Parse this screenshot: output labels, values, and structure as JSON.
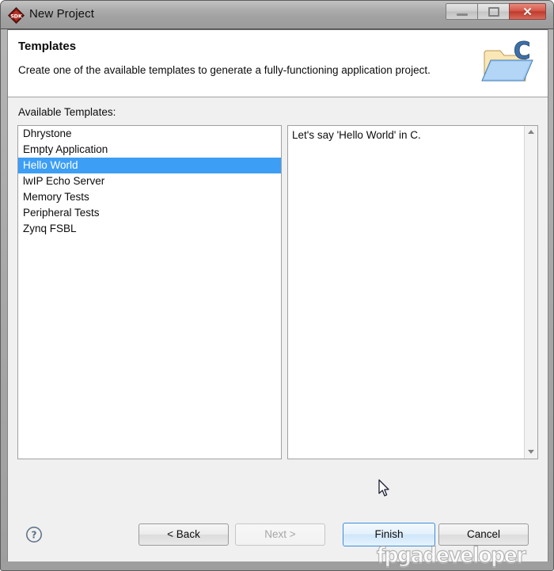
{
  "window": {
    "title": "New Project",
    "app_icon": "sdk-diamond-icon",
    "controls": {
      "minimize": "minimize-icon",
      "maximize": "maximize-icon",
      "close_label": "✕"
    }
  },
  "header": {
    "title": "Templates",
    "description": "Create one of the available templates to generate a fully-functioning application project.",
    "icon": "c-project-folder-icon"
  },
  "main": {
    "available_label": "Available Templates:",
    "templates": [
      {
        "label": "Dhrystone",
        "selected": false
      },
      {
        "label": "Empty Application",
        "selected": false
      },
      {
        "label": "Hello World",
        "selected": true
      },
      {
        "label": "lwIP Echo Server",
        "selected": false
      },
      {
        "label": "Memory Tests",
        "selected": false
      },
      {
        "label": "Peripheral Tests",
        "selected": false
      },
      {
        "label": "Zynq FSBL",
        "selected": false
      }
    ],
    "description_panel": {
      "text": "Let's say 'Hello World' in C.",
      "scrollbar": {
        "up_arrow": "scroll-up-icon",
        "down_arrow": "scroll-down-icon"
      }
    }
  },
  "footer": {
    "help_icon": "help-question-icon",
    "buttons": {
      "back": "< Back",
      "next": "Next >",
      "finish": "Finish",
      "cancel": "Cancel"
    }
  },
  "overlay": {
    "watermark": "fpgadeveloper",
    "cursor": "arrow-cursor"
  },
  "colors": {
    "selection_blue": "#3c9ef5",
    "default_button_border": "#3c8edb",
    "close_button_red": "#bf3b2c",
    "body_background": "#f0f0f0"
  }
}
